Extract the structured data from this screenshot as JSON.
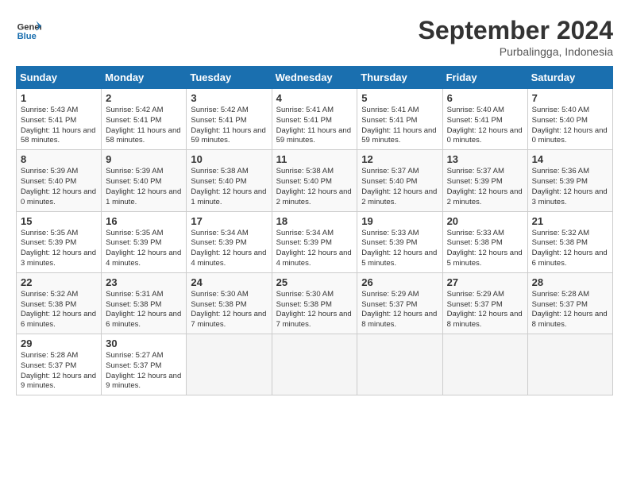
{
  "header": {
    "logo_line1": "General",
    "logo_line2": "Blue",
    "month_title": "September 2024",
    "location": "Purbalingga, Indonesia"
  },
  "weekdays": [
    "Sunday",
    "Monday",
    "Tuesday",
    "Wednesday",
    "Thursday",
    "Friday",
    "Saturday"
  ],
  "weeks": [
    [
      {
        "day": "1",
        "info": "Sunrise: 5:43 AM\nSunset: 5:41 PM\nDaylight: 11 hours\nand 58 minutes."
      },
      {
        "day": "2",
        "info": "Sunrise: 5:42 AM\nSunset: 5:41 PM\nDaylight: 11 hours\nand 58 minutes."
      },
      {
        "day": "3",
        "info": "Sunrise: 5:42 AM\nSunset: 5:41 PM\nDaylight: 11 hours\nand 59 minutes."
      },
      {
        "day": "4",
        "info": "Sunrise: 5:41 AM\nSunset: 5:41 PM\nDaylight: 11 hours\nand 59 minutes."
      },
      {
        "day": "5",
        "info": "Sunrise: 5:41 AM\nSunset: 5:41 PM\nDaylight: 11 hours\nand 59 minutes."
      },
      {
        "day": "6",
        "info": "Sunrise: 5:40 AM\nSunset: 5:41 PM\nDaylight: 12 hours\nand 0 minutes."
      },
      {
        "day": "7",
        "info": "Sunrise: 5:40 AM\nSunset: 5:40 PM\nDaylight: 12 hours\nand 0 minutes."
      }
    ],
    [
      {
        "day": "8",
        "info": "Sunrise: 5:39 AM\nSunset: 5:40 PM\nDaylight: 12 hours\nand 0 minutes."
      },
      {
        "day": "9",
        "info": "Sunrise: 5:39 AM\nSunset: 5:40 PM\nDaylight: 12 hours\nand 1 minute."
      },
      {
        "day": "10",
        "info": "Sunrise: 5:38 AM\nSunset: 5:40 PM\nDaylight: 12 hours\nand 1 minute."
      },
      {
        "day": "11",
        "info": "Sunrise: 5:38 AM\nSunset: 5:40 PM\nDaylight: 12 hours\nand 2 minutes."
      },
      {
        "day": "12",
        "info": "Sunrise: 5:37 AM\nSunset: 5:40 PM\nDaylight: 12 hours\nand 2 minutes."
      },
      {
        "day": "13",
        "info": "Sunrise: 5:37 AM\nSunset: 5:39 PM\nDaylight: 12 hours\nand 2 minutes."
      },
      {
        "day": "14",
        "info": "Sunrise: 5:36 AM\nSunset: 5:39 PM\nDaylight: 12 hours\nand 3 minutes."
      }
    ],
    [
      {
        "day": "15",
        "info": "Sunrise: 5:35 AM\nSunset: 5:39 PM\nDaylight: 12 hours\nand 3 minutes."
      },
      {
        "day": "16",
        "info": "Sunrise: 5:35 AM\nSunset: 5:39 PM\nDaylight: 12 hours\nand 4 minutes."
      },
      {
        "day": "17",
        "info": "Sunrise: 5:34 AM\nSunset: 5:39 PM\nDaylight: 12 hours\nand 4 minutes."
      },
      {
        "day": "18",
        "info": "Sunrise: 5:34 AM\nSunset: 5:39 PM\nDaylight: 12 hours\nand 4 minutes."
      },
      {
        "day": "19",
        "info": "Sunrise: 5:33 AM\nSunset: 5:39 PM\nDaylight: 12 hours\nand 5 minutes."
      },
      {
        "day": "20",
        "info": "Sunrise: 5:33 AM\nSunset: 5:38 PM\nDaylight: 12 hours\nand 5 minutes."
      },
      {
        "day": "21",
        "info": "Sunrise: 5:32 AM\nSunset: 5:38 PM\nDaylight: 12 hours\nand 6 minutes."
      }
    ],
    [
      {
        "day": "22",
        "info": "Sunrise: 5:32 AM\nSunset: 5:38 PM\nDaylight: 12 hours\nand 6 minutes."
      },
      {
        "day": "23",
        "info": "Sunrise: 5:31 AM\nSunset: 5:38 PM\nDaylight: 12 hours\nand 6 minutes."
      },
      {
        "day": "24",
        "info": "Sunrise: 5:30 AM\nSunset: 5:38 PM\nDaylight: 12 hours\nand 7 minutes."
      },
      {
        "day": "25",
        "info": "Sunrise: 5:30 AM\nSunset: 5:38 PM\nDaylight: 12 hours\nand 7 minutes."
      },
      {
        "day": "26",
        "info": "Sunrise: 5:29 AM\nSunset: 5:37 PM\nDaylight: 12 hours\nand 8 minutes."
      },
      {
        "day": "27",
        "info": "Sunrise: 5:29 AM\nSunset: 5:37 PM\nDaylight: 12 hours\nand 8 minutes."
      },
      {
        "day": "28",
        "info": "Sunrise: 5:28 AM\nSunset: 5:37 PM\nDaylight: 12 hours\nand 8 minutes."
      }
    ],
    [
      {
        "day": "29",
        "info": "Sunrise: 5:28 AM\nSunset: 5:37 PM\nDaylight: 12 hours\nand 9 minutes."
      },
      {
        "day": "30",
        "info": "Sunrise: 5:27 AM\nSunset: 5:37 PM\nDaylight: 12 hours\nand 9 minutes."
      },
      {
        "day": "",
        "info": ""
      },
      {
        "day": "",
        "info": ""
      },
      {
        "day": "",
        "info": ""
      },
      {
        "day": "",
        "info": ""
      },
      {
        "day": "",
        "info": ""
      }
    ]
  ]
}
